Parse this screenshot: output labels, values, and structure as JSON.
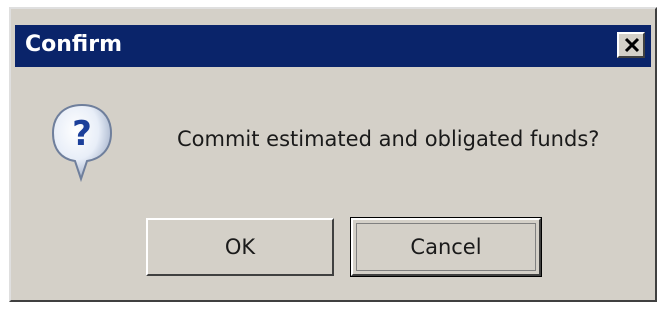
{
  "dialog": {
    "title": "Confirm",
    "message": "Commit estimated and obligated funds?",
    "icon": "question-icon",
    "close_icon": "close-icon",
    "buttons": {
      "ok_label": "OK",
      "cancel_label": "Cancel"
    },
    "colors": {
      "titlebar": "#0a246a",
      "face": "#d4d0c8",
      "title_text": "#ffffff"
    }
  }
}
